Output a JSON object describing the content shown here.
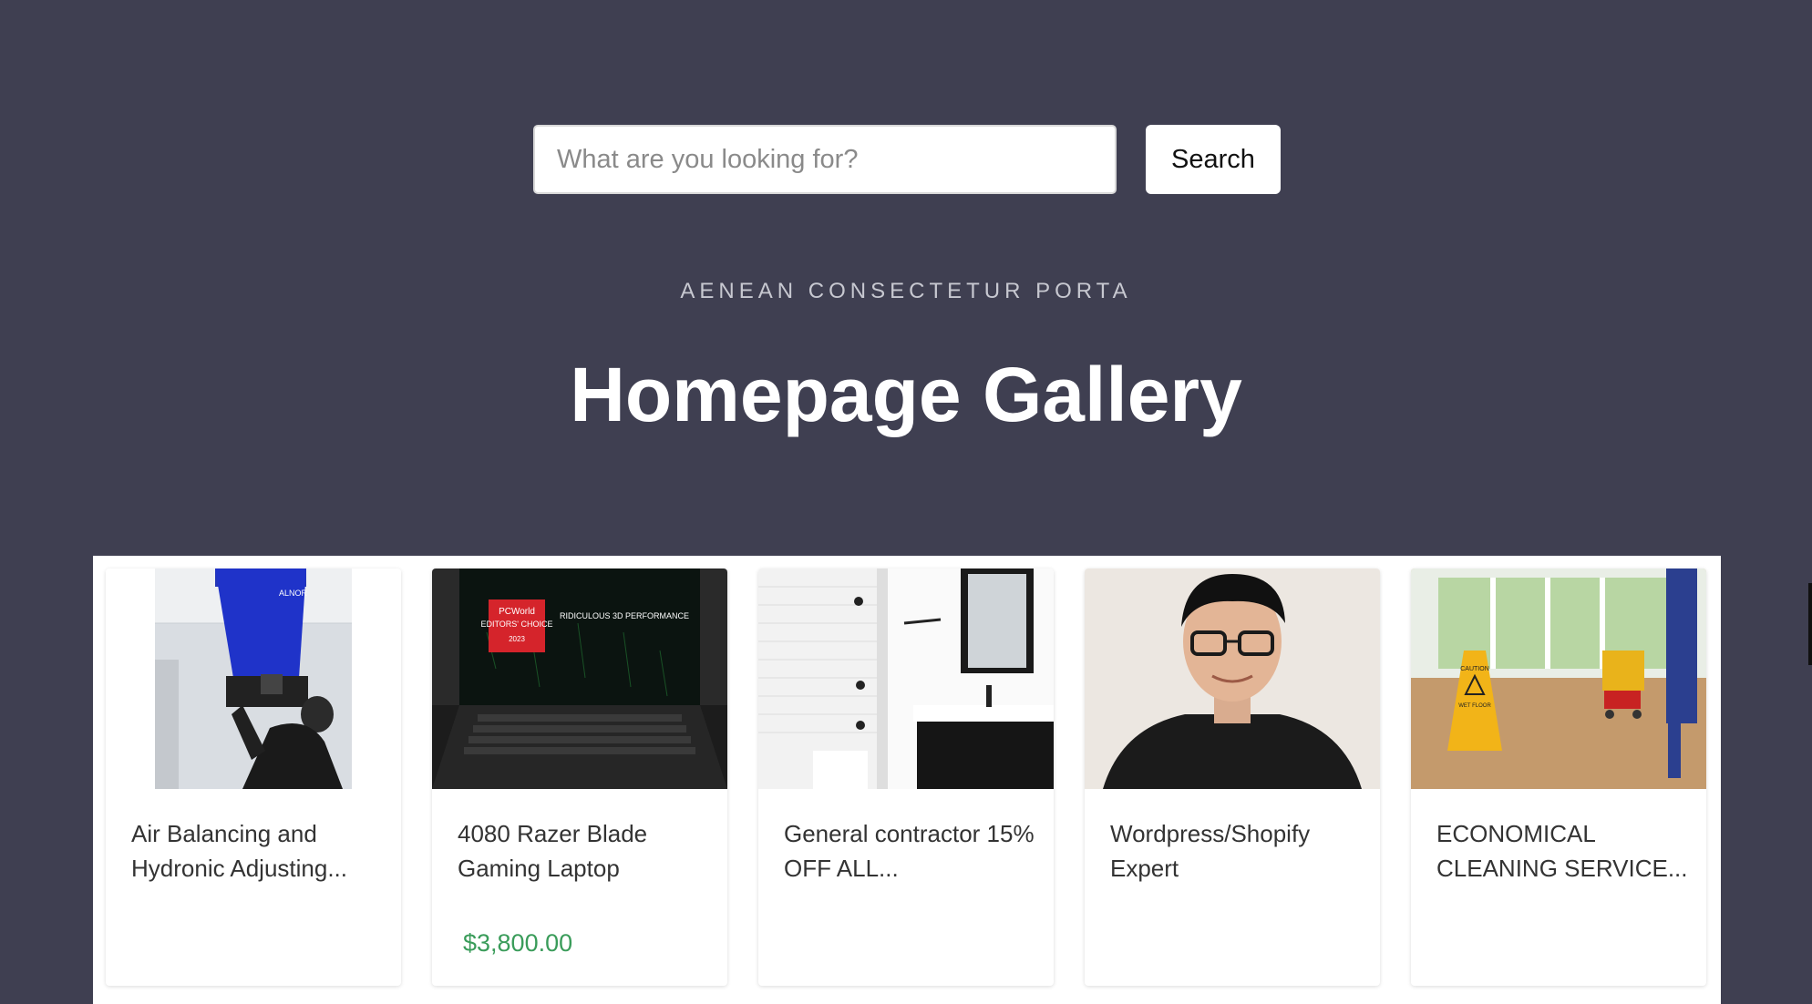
{
  "search": {
    "placeholder": "What are you looking for?",
    "button_label": "Search"
  },
  "hero": {
    "eyebrow": "AENEAN CONSECTETUR PORTA",
    "title": "Homepage Gallery"
  },
  "gallery": {
    "items": [
      {
        "title": "Air Balancing and Hydronic Adjusting...",
        "price": ""
      },
      {
        "title": "4080 Razer Blade Gaming Laptop",
        "price": "$3,800.00"
      },
      {
        "title": "General contractor 15% OFF ALL...",
        "price": ""
      },
      {
        "title": "Wordpress/Shopify Expert",
        "price": ""
      },
      {
        "title": "ECONOMICAL CLEANING SERVICE...",
        "price": ""
      }
    ],
    "image_overlays": {
      "brand": "ALNOR",
      "award": [
        "PCWorld",
        "EDITORS' CHOICE",
        "2023"
      ],
      "quote": "RIDICULOUS 3D PERFORMANCE",
      "sign": [
        "CAUTION",
        "WET FLOOR"
      ]
    }
  },
  "colors": {
    "page_bg": "#3f3f51",
    "price": "#3a9c5a"
  }
}
